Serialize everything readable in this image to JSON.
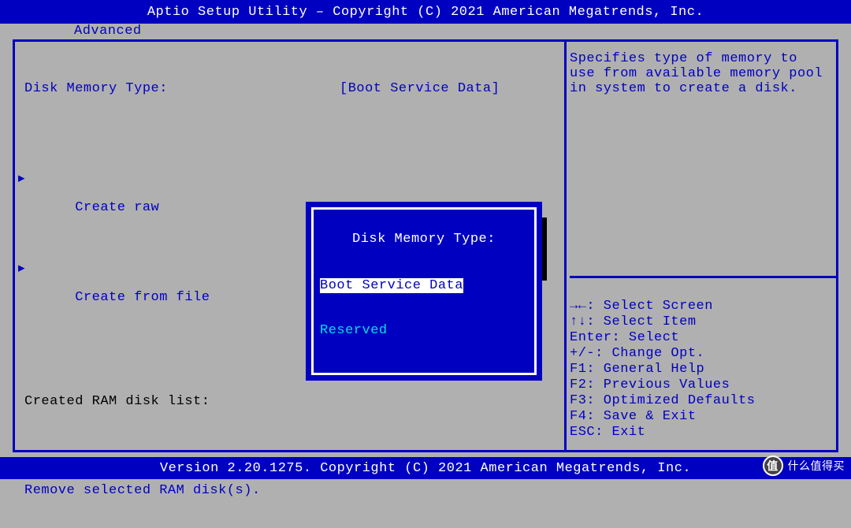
{
  "header": {
    "title": "Aptio Setup Utility – Copyright (C) 2021 American Megatrends, Inc."
  },
  "tabs": {
    "advanced": "Advanced"
  },
  "left": {
    "setting_label": "Disk Memory Type:",
    "setting_value": "[Boot Service Data]",
    "create_raw": "Create raw",
    "create_from_file": "Create from file",
    "ram_list_label": "Created RAM disk list:",
    "remove": "Remove selected RAM disk(s)."
  },
  "popup": {
    "title": "Disk Memory Type:",
    "opt_selected": "Boot Service Data",
    "opt_other": "Reserved"
  },
  "help": {
    "text": "Specifies type of memory to use from available memory pool in system to create a disk."
  },
  "keys": {
    "select_screen": "→←: Select Screen",
    "select_item": "↑↓: Select Item",
    "enter": "Enter: Select",
    "change": "+/-: Change Opt.",
    "f1": "F1: General Help",
    "f2": "F2: Previous Values",
    "f3": "F3: Optimized Defaults",
    "f4": "F4: Save & Exit",
    "esc": "ESC: Exit"
  },
  "footer": {
    "text": "Version 2.20.1275. Copyright (C) 2021 American Megatrends, Inc."
  },
  "watermark": {
    "badge": "值",
    "text": "什么值得买"
  }
}
